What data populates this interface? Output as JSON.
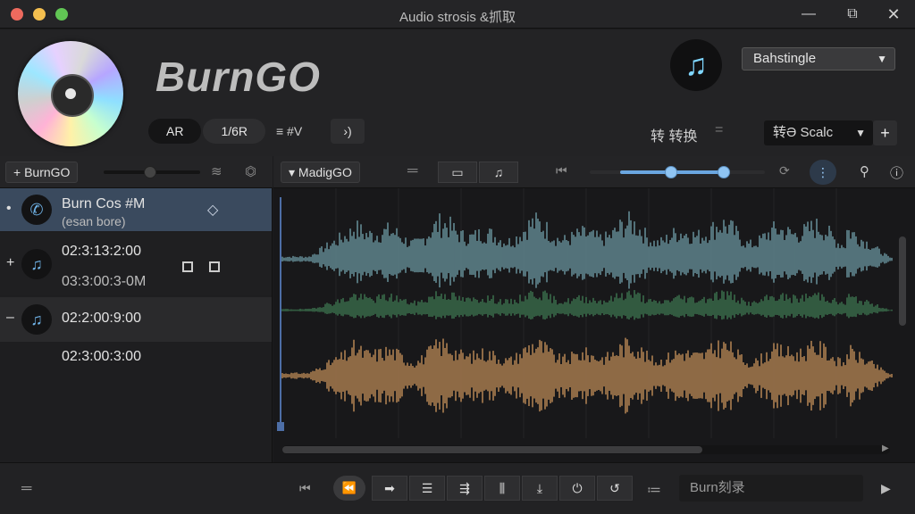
{
  "window": {
    "title": "Audio strosis &抓取",
    "minimize_glyph": "—",
    "maximize_glyph": "⧉",
    "close_glyph": "✕"
  },
  "header": {
    "logo_text": "BurnGO",
    "pills": [
      "AR",
      "1/6R"
    ],
    "label_right_of_pills": "≡ #V",
    "action_glyph": "›)",
    "profile_select": "Bahstingle",
    "convert_label": "转 转换",
    "eq_glyph": "=",
    "scale_select": "转Ә Scalc",
    "plus_glyph": "+"
  },
  "sidebar": {
    "tag": "+ BurnGO",
    "tracks": [
      {
        "title": "Burn Cos #M",
        "subtitle": "(esan bore)",
        "dot": "•",
        "icon": "phone-icon"
      },
      {
        "title": "02:3:13:2:00",
        "subtitle": "03:3:00:3-0M",
        "dot": "+",
        "icon": "music-note-icon"
      },
      {
        "title": "02:2:00:9:00",
        "subtitle": "",
        "dot": "–",
        "icon": "music-note-icon"
      }
    ],
    "extra_time": "02:3:00:3:00"
  },
  "waveform": {
    "tag": "▾ MadigGO",
    "colors": {
      "track_a": "#6f9ea8",
      "track_b": "#3f7a52",
      "track_c": "#c6905a",
      "playhead": "#4d6ea6"
    }
  },
  "transport": {
    "burn_field_text": "Burn刻录"
  },
  "colors": {
    "accent": "#6fb2e6",
    "selection": "#3a4a5e",
    "background": "#1b1b1d"
  }
}
